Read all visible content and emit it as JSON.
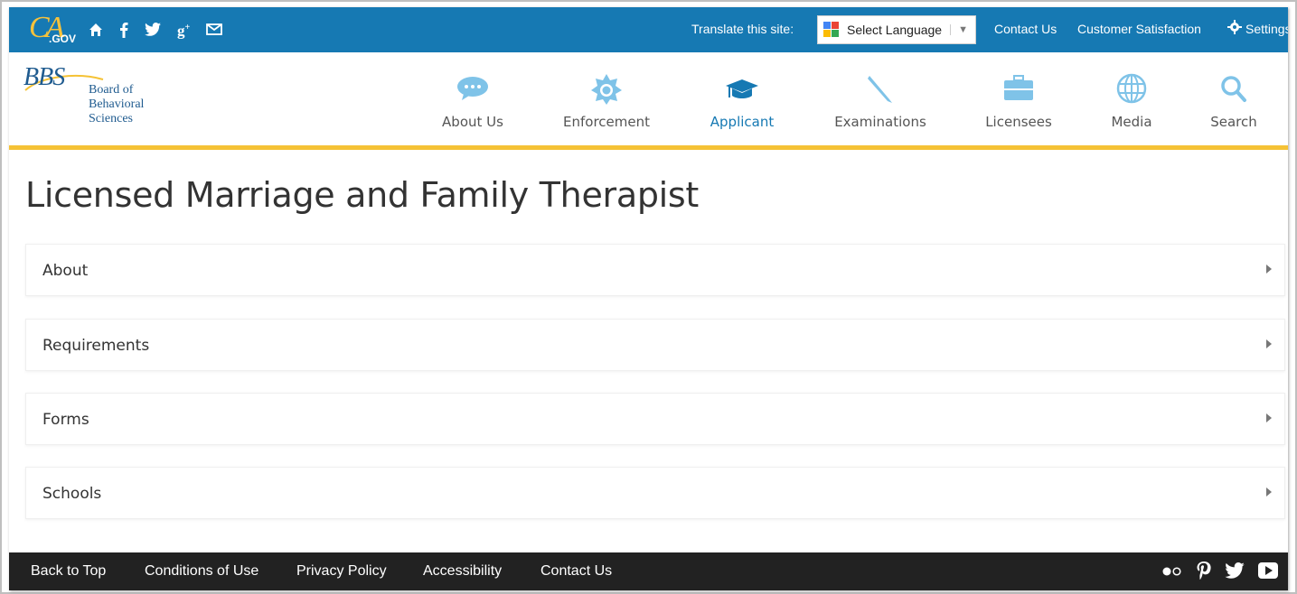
{
  "topbar": {
    "logo_text": "CA",
    "logo_gov": ".GOV",
    "social_icons": [
      "home-icon",
      "facebook-icon",
      "twitter-icon",
      "google-plus-icon",
      "email-icon"
    ],
    "translate_label": "Translate this site:",
    "language_select_value": "Select Language",
    "links": [
      "Contact Us",
      "Customer Satisfaction"
    ],
    "settings_label": "Settings",
    "bar_color": "#1679b3"
  },
  "header": {
    "logo_mark": "BBS",
    "logo_line1": "Board of",
    "logo_line2": "Behavioral",
    "logo_line3": "Sciences",
    "nav": [
      {
        "label": "About Us",
        "icon": "speech-bubble-icon"
      },
      {
        "label": "Enforcement",
        "icon": "badge-icon"
      },
      {
        "label": "Applicant",
        "icon": "graduation-cap-icon",
        "active": true
      },
      {
        "label": "Examinations",
        "icon": "pencil-icon"
      },
      {
        "label": "Licensees",
        "icon": "briefcase-icon"
      },
      {
        "label": "Media",
        "icon": "globe-icon"
      },
      {
        "label": "Search",
        "icon": "search-icon"
      }
    ],
    "accent_color": "#f5c235"
  },
  "main": {
    "title": "Licensed Marriage and Family Therapist",
    "sections": [
      "About",
      "Requirements",
      "Forms",
      "Schools"
    ]
  },
  "footer": {
    "links": [
      "Back to Top",
      "Conditions of Use",
      "Privacy Policy",
      "Accessibility",
      "Contact Us"
    ],
    "icons": [
      "flickr-icon",
      "pinterest-icon",
      "twitter-icon",
      "youtube-icon"
    ]
  }
}
